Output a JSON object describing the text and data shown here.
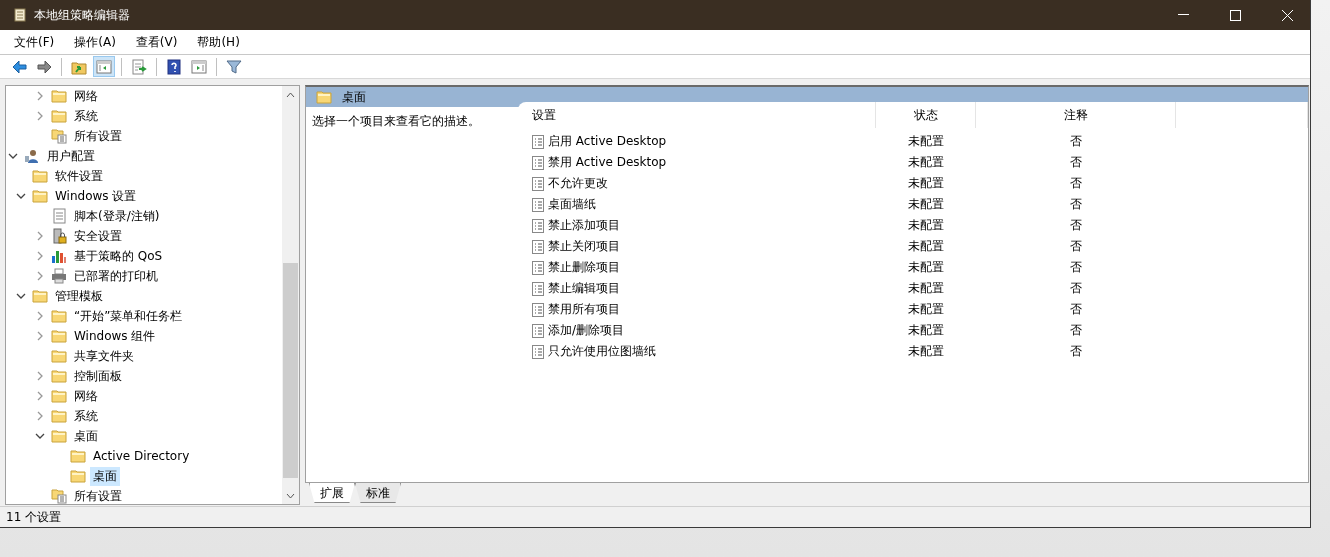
{
  "window": {
    "title": "本地组策略编辑器"
  },
  "menu": [
    "文件(F)",
    "操作(A)",
    "查看(V)",
    "帮助(H)"
  ],
  "toolbar": [
    {
      "kind": "back",
      "pressed": false
    },
    {
      "kind": "forward",
      "pressed": false
    },
    {
      "kind": "separator"
    },
    {
      "kind": "up",
      "pressed": false
    },
    {
      "kind": "tree",
      "pressed": true
    },
    {
      "kind": "separator"
    },
    {
      "kind": "export",
      "pressed": false
    },
    {
      "kind": "separator"
    },
    {
      "kind": "help",
      "pressed": false
    },
    {
      "kind": "pane",
      "pressed": false
    },
    {
      "kind": "separator"
    },
    {
      "kind": "filter",
      "pressed": false
    }
  ],
  "tree": [
    {
      "children": [
        {
          "children": [
            {
              "label": "网络",
              "kind": "folder",
              "expanded": false,
              "selected": false
            },
            {
              "label": "系统",
              "kind": "folder",
              "expanded": false,
              "selected": false
            },
            {
              "label": "所有设置",
              "kind": "settings",
              "selected": false
            }
          ]
        }
      ]
    },
    {
      "label": "用户配置",
      "kind": "user",
      "expanded": true,
      "selected": false,
      "children": [
        {
          "label": "软件设置",
          "kind": "folder",
          "selected": false
        },
        {
          "label": "Windows 设置",
          "kind": "folder",
          "expanded": true,
          "selected": false,
          "children": [
            {
              "label": "脚本(登录/注销)",
              "kind": "script",
              "selected": false
            },
            {
              "label": "安全设置",
              "kind": "security",
              "expanded": false,
              "selected": false
            },
            {
              "label": "基于策略的 QoS",
              "kind": "qos",
              "expanded": false,
              "selected": false
            },
            {
              "label": "已部署的打印机",
              "kind": "printer",
              "expanded": false,
              "selected": false
            }
          ]
        },
        {
          "label": "管理模板",
          "kind": "folder",
          "expanded": true,
          "selected": false,
          "children": [
            {
              "label": "“开始”菜单和任务栏",
              "kind": "folder",
              "expanded": false,
              "selected": false
            },
            {
              "label": "Windows 组件",
              "kind": "folder",
              "expanded": false,
              "selected": false
            },
            {
              "label": "共享文件夹",
              "kind": "folder",
              "selected": false
            },
            {
              "label": "控制面板",
              "kind": "folder",
              "expanded": false,
              "selected": false
            },
            {
              "label": "网络",
              "kind": "folder",
              "expanded": false,
              "selected": false
            },
            {
              "label": "系统",
              "kind": "folder",
              "expanded": false,
              "selected": false
            },
            {
              "label": "桌面",
              "kind": "folder",
              "expanded": true,
              "selected": false,
              "children": [
                {
                  "label": "Active Directory",
                  "kind": "folder",
                  "selected": false
                },
                {
                  "label": "桌面",
                  "kind": "folder",
                  "selected": true
                }
              ]
            },
            {
              "label": "所有设置",
              "kind": "settings",
              "selected": false
            }
          ]
        }
      ]
    }
  ],
  "panel": {
    "title": "桌面",
    "description": "选择一个项目来查看它的描述。",
    "columns": [
      "设置",
      "状态",
      "注释"
    ],
    "rows": [
      {
        "setting": "启用 Active Desktop",
        "state": "未配置",
        "comment": "否"
      },
      {
        "setting": "禁用 Active Desktop",
        "state": "未配置",
        "comment": "否"
      },
      {
        "setting": "不允许更改",
        "state": "未配置",
        "comment": "否"
      },
      {
        "setting": "桌面墙纸",
        "state": "未配置",
        "comment": "否"
      },
      {
        "setting": "禁止添加项目",
        "state": "未配置",
        "comment": "否"
      },
      {
        "setting": "禁止关闭项目",
        "state": "未配置",
        "comment": "否"
      },
      {
        "setting": "禁止删除项目",
        "state": "未配置",
        "comment": "否"
      },
      {
        "setting": "禁止编辑项目",
        "state": "未配置",
        "comment": "否"
      },
      {
        "setting": "禁用所有项目",
        "state": "未配置",
        "comment": "否"
      },
      {
        "setting": "添加/删除项目",
        "state": "未配置",
        "comment": "否"
      },
      {
        "setting": "只允许使用位图墙纸",
        "state": "未配置",
        "comment": "否"
      }
    ]
  },
  "view_tabs": [
    {
      "label": "扩展",
      "selected": true
    },
    {
      "label": "标准",
      "selected": false
    }
  ],
  "status_bar": "11 个设置"
}
